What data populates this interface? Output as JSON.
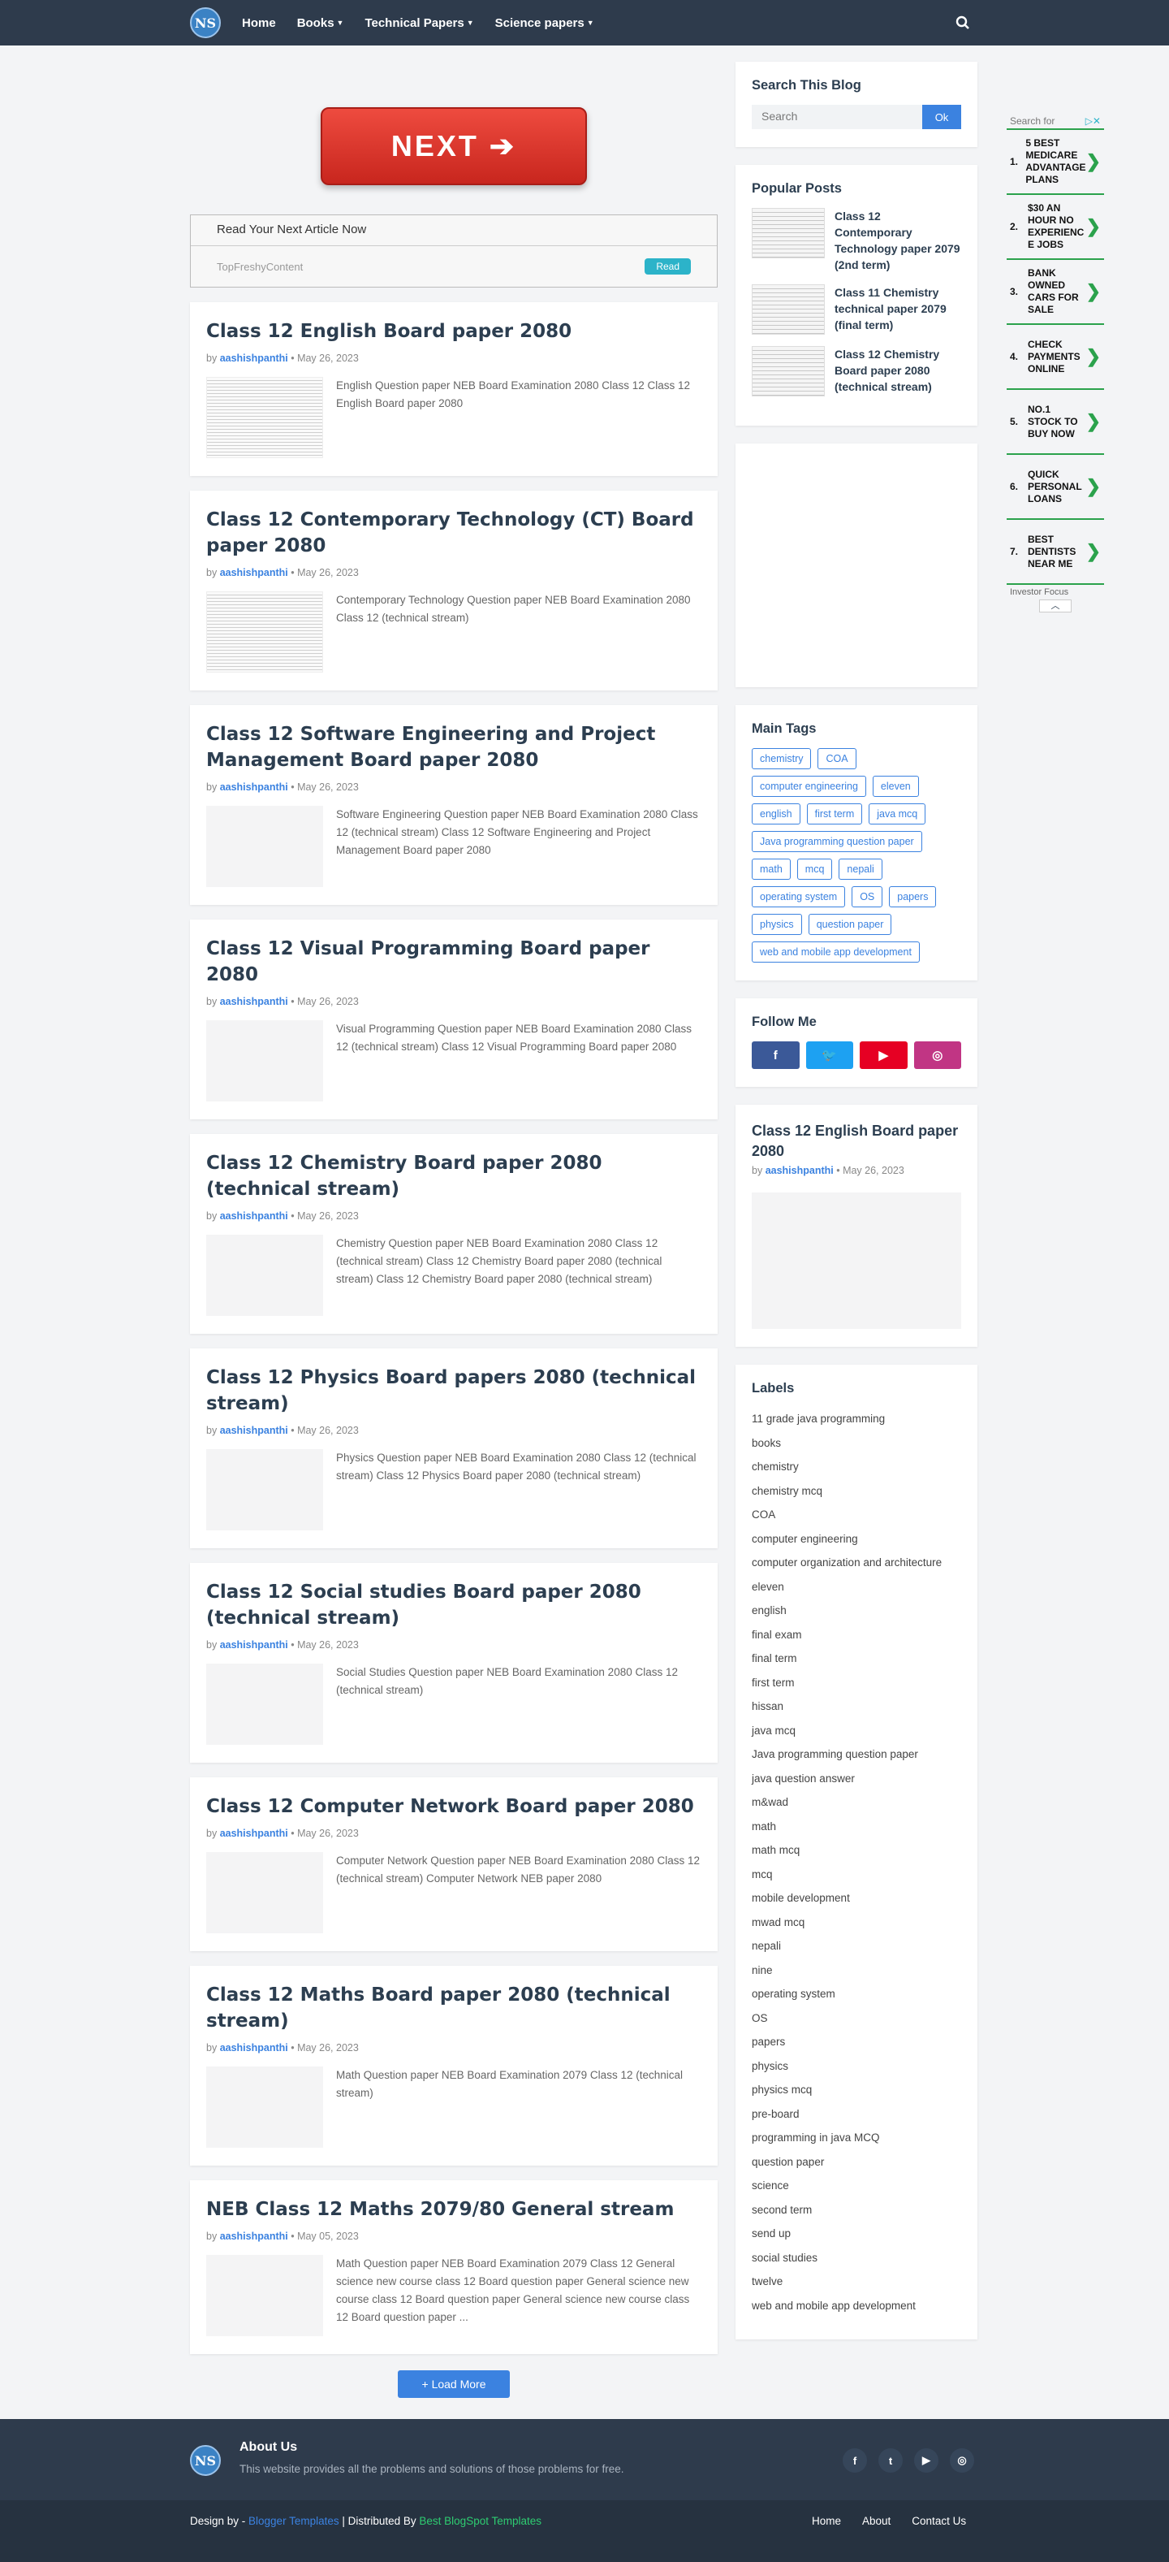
{
  "header": {
    "logo_text": "NS",
    "nav": [
      {
        "label": "Home",
        "caret": false
      },
      {
        "label": "Books",
        "caret": true
      },
      {
        "label": "Technical Papers",
        "caret": true
      },
      {
        "label": "Science papers",
        "caret": true
      }
    ]
  },
  "banner": {
    "next_label": "NEXT ➔"
  },
  "ad": {
    "title": "Read Your Next Article Now",
    "source": "TopFreshyContent",
    "button": "Read"
  },
  "posts": [
    {
      "title": "Class 12 English Board paper 2080",
      "by": "by",
      "author": "aashishpanthi",
      "date": "May 26, 2023",
      "snippet": "English Question paper NEB Board Examination 2080 Class 12 Class 12 English Board paper 2080",
      "thumb": "scan"
    },
    {
      "title": "Class 12 Contemporary Technology (CT) Board paper 2080",
      "by": "by",
      "author": "aashishpanthi",
      "date": "May 26, 2023",
      "snippet": "Contemporary Technology Question paper NEB Board Examination 2080 Class 12 (technical stream)",
      "thumb": "scan"
    },
    {
      "title": "Class 12 Software Engineering and Project Management Board paper 2080",
      "by": "by",
      "author": "aashishpanthi",
      "date": "May 26, 2023",
      "snippet": "Software Engineering Question paper NEB Board Examination 2080 Class 12 (technical stream) Class 12 Software Engineering and Project Management Board paper 2080",
      "thumb": "blank"
    },
    {
      "title": "Class 12 Visual Programming Board paper 2080",
      "by": "by",
      "author": "aashishpanthi",
      "date": "May 26, 2023",
      "snippet": "Visual Programming Question paper NEB Board Examination 2080 Class 12 (technical stream) Class 12 Visual Programming Board paper 2080",
      "thumb": "blank"
    },
    {
      "title": "Class 12 Chemistry Board paper 2080 (technical stream)",
      "by": "by",
      "author": "aashishpanthi",
      "date": "May 26, 2023",
      "snippet": "Chemistry Question paper NEB Board Examination 2080 Class 12 (technical stream) Class 12 Chemistry Board paper 2080 (technical stream) Class 12 Chemistry Board paper 2080 (technical stream)",
      "thumb": "blank"
    },
    {
      "title": "Class 12 Physics Board papers 2080 (technical stream)",
      "by": "by",
      "author": "aashishpanthi",
      "date": "May 26, 2023",
      "snippet": "Physics Question paper NEB Board Examination 2080 Class 12 (technical stream) Class 12 Physics Board paper 2080 (technical stream)",
      "thumb": "blank"
    },
    {
      "title": "Class 12 Social studies Board paper 2080 (technical stream)",
      "by": "by",
      "author": "aashishpanthi",
      "date": "May 26, 2023",
      "snippet": "Social Studies Question paper NEB Board Examination 2080 Class 12 (technical stream)",
      "thumb": "blank"
    },
    {
      "title": "Class 12 Computer Network Board paper 2080",
      "by": "by",
      "author": "aashishpanthi",
      "date": "May 26, 2023",
      "snippet": "Computer Network Question paper NEB Board Examination 2080 Class 12 (technical stream) Computer Network NEB paper 2080",
      "thumb": "blank"
    },
    {
      "title": "Class 12 Maths Board paper 2080 (technical stream)",
      "by": "by",
      "author": "aashishpanthi",
      "date": "May 26, 2023",
      "snippet": "Math Question paper NEB Board Examination 2079 Class 12 (technical stream)",
      "thumb": "blank"
    },
    {
      "title": "NEB Class 12 Maths 2079/80 General stream",
      "by": "by",
      "author": "aashishpanthi",
      "date": "May 05, 2023",
      "snippet": "Math Question paper NEB Board Examination 2079 Class 12 General science new course class 12 Board question paper General science new course class 12 Board question paper General science new course class 12 Board question paper ...",
      "thumb": "blank"
    }
  ],
  "load_more": "+ Load More",
  "sidebar": {
    "search": {
      "title": "Search This Blog",
      "placeholder": "Search",
      "button": "Ok"
    },
    "popular": {
      "title": "Popular Posts",
      "items": [
        "Class 12 Contemporary Technology paper 2079 (2nd term)",
        "Class 11 Chemistry technical paper 2079 (final term)",
        "Class 12 Chemistry Board paper 2080 (technical stream)"
      ]
    },
    "tags": {
      "title": "Main Tags",
      "items": [
        "chemistry",
        "COA",
        "computer engineering",
        "eleven",
        "english",
        "first term",
        "java mcq",
        "Java programming question paper",
        "math",
        "mcq",
        "nepali",
        "operating system",
        "OS",
        "papers",
        "physics",
        "question paper",
        "web and mobile app development"
      ]
    },
    "follow": {
      "title": "Follow Me",
      "buttons": [
        {
          "name": "facebook",
          "glyph": "f",
          "color": "#3b5998"
        },
        {
          "name": "twitter",
          "glyph": "🐦",
          "color": "#1da1f2"
        },
        {
          "name": "youtube",
          "glyph": "▶",
          "color": "#e60023"
        },
        {
          "name": "instagram",
          "glyph": "◎",
          "color": "#c13584"
        }
      ]
    },
    "featured": {
      "title": "Class 12 English Board paper 2080",
      "by": "by",
      "author": "aashishpanthi",
      "date": "May 26, 2023"
    },
    "labels": {
      "title": "Labels",
      "items": [
        "11 grade java programming",
        "books",
        "chemistry",
        "chemistry mcq",
        "COA",
        "computer engineering",
        "computer organization and architecture",
        "eleven",
        "english",
        "final exam",
        "final term",
        "first term",
        "hissan",
        "java mcq",
        "Java programming question paper",
        "java question answer",
        "m&wad",
        "math",
        "math mcq",
        "mcq",
        "mobile development",
        "mwad mcq",
        "nepali",
        "nine",
        "operating system",
        "OS",
        "papers",
        "physics",
        "physics mcq",
        "pre-board",
        "programming in java MCQ",
        "question paper",
        "science",
        "second term",
        "send up",
        "social studies",
        "twelve",
        "web and mobile app development"
      ]
    }
  },
  "right_ad": {
    "header": "Search for",
    "items": [
      "5 BEST MEDICARE ADVANTAGE PLANS",
      "$30 AN HOUR NO EXPERIENC E JOBS",
      "BANK OWNED CARS FOR SALE",
      "CHECK PAYMENTS ONLINE",
      "NO.1 STOCK TO BUY NOW",
      "QUICK PERSONAL LOANS",
      "BEST DENTISTS NEAR ME"
    ],
    "footer": "Investor Focus"
  },
  "footer": {
    "about_title": "About Us",
    "about_text": "This website provides all the problems and solutions of those problems for free.",
    "social": [
      "f",
      "t",
      "▶",
      "◎"
    ],
    "credit_prefix": "Design by - ",
    "credit_a": "Blogger Templates",
    "credit_mid": " | Distributed By ",
    "credit_b": "Best BlogSpot Templates",
    "nav": [
      "Home",
      "About",
      "Contact Us"
    ]
  }
}
